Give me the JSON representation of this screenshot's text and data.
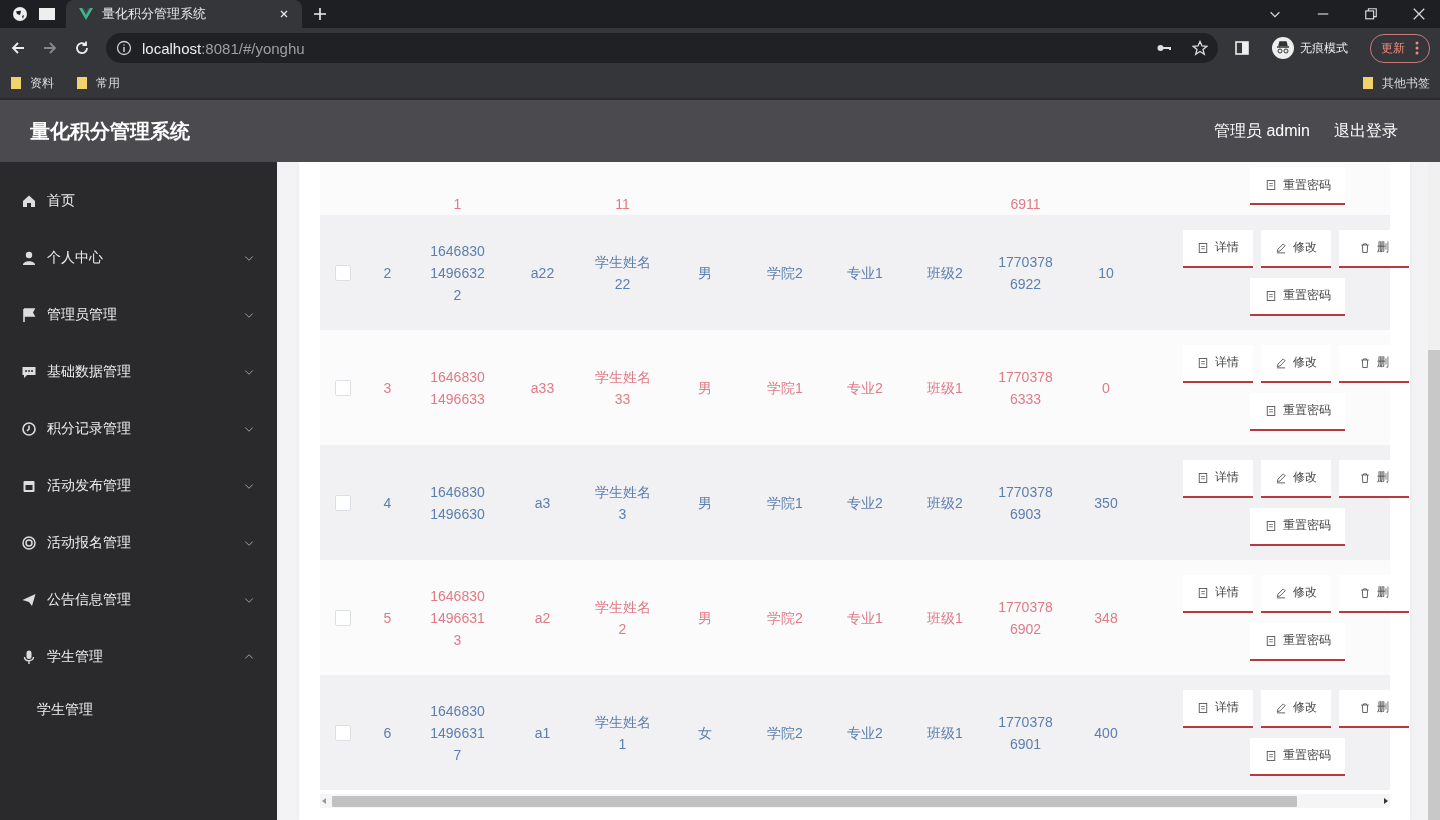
{
  "browser": {
    "tab": {
      "title": "量化积分管理系统",
      "selected": true
    },
    "url_host": "localhost",
    "url_path": ":8081/#/yonghu",
    "profile": "无痕模式",
    "update": "更新",
    "bookmarks": [
      "资料",
      "常用"
    ],
    "other_bookmarks": "其他书签"
  },
  "header": {
    "title": "量化积分管理系统",
    "user": "管理员 admin",
    "logout": "退出登录"
  },
  "sidebar": {
    "items": [
      {
        "label": "首页",
        "has_children": false
      },
      {
        "label": "个人中心",
        "has_children": true,
        "expanded": false
      },
      {
        "label": "管理员管理",
        "has_children": true,
        "expanded": false
      },
      {
        "label": "基础数据管理",
        "has_children": true,
        "expanded": false
      },
      {
        "label": "积分记录管理",
        "has_children": true,
        "expanded": false
      },
      {
        "label": "活动发布管理",
        "has_children": true,
        "expanded": false
      },
      {
        "label": "活动报名管理",
        "has_children": true,
        "expanded": false
      },
      {
        "label": "公告信息管理",
        "has_children": true,
        "expanded": false
      },
      {
        "label": "学生管理",
        "has_children": true,
        "expanded": true,
        "children": [
          {
            "label": "学生管理"
          }
        ]
      }
    ]
  },
  "table": {
    "clipped_row": {
      "color": "#e07a86",
      "account": "1",
      "name": "11",
      "phone": "6911",
      "reset": "重置密码"
    },
    "rows": [
      {
        "checked": false,
        "color": "#5b7fae",
        "index": "2",
        "account": "164683014966322",
        "username": "a22",
        "name": "学生姓名22",
        "gender": "男",
        "college": "学院2",
        "major": "专业1",
        "class": "班级2",
        "phone": "17703786922",
        "points": "10",
        "actions": [
          {
            "kind": "detail",
            "label": "详情"
          },
          {
            "kind": "edit",
            "label": "修改"
          },
          {
            "kind": "delete",
            "label": "删"
          },
          {
            "kind": "reset",
            "label": "重置密码"
          }
        ]
      },
      {
        "checked": false,
        "color": "#e07a86",
        "index": "3",
        "account": "16468301496633",
        "username": "a33",
        "name": "学生姓名33",
        "gender": "男",
        "college": "学院1",
        "major": "专业2",
        "class": "班级1",
        "phone": "17703786333",
        "points": "0",
        "actions": [
          {
            "kind": "detail",
            "label": "详情"
          },
          {
            "kind": "edit",
            "label": "修改"
          },
          {
            "kind": "delete",
            "label": "删"
          },
          {
            "kind": "reset",
            "label": "重置密码"
          }
        ]
      },
      {
        "checked": false,
        "color": "#5b7fae",
        "index": "4",
        "account": "16468301496630",
        "username": "a3",
        "name": "学生姓名3",
        "gender": "男",
        "college": "学院1",
        "major": "专业2",
        "class": "班级2",
        "phone": "17703786903",
        "points": "350",
        "actions": [
          {
            "kind": "detail",
            "label": "详情"
          },
          {
            "kind": "edit",
            "label": "修改"
          },
          {
            "kind": "delete",
            "label": "删"
          },
          {
            "kind": "reset",
            "label": "重置密码"
          }
        ]
      },
      {
        "checked": false,
        "color": "#e07a86",
        "index": "5",
        "account": "164683014966313",
        "username": "a2",
        "name": "学生姓名2",
        "gender": "男",
        "college": "学院2",
        "major": "专业1",
        "class": "班级1",
        "phone": "17703786902",
        "points": "348",
        "actions": [
          {
            "kind": "detail",
            "label": "详情"
          },
          {
            "kind": "edit",
            "label": "修改"
          },
          {
            "kind": "delete",
            "label": "删"
          },
          {
            "kind": "reset",
            "label": "重置密码"
          }
        ]
      },
      {
        "checked": false,
        "color": "#5b7fae",
        "index": "6",
        "account": "164683014966317",
        "username": "a1",
        "name": "学生姓名1",
        "gender": "女",
        "college": "学院2",
        "major": "专业2",
        "class": "班级1",
        "phone": "17703786901",
        "points": "400",
        "actions": [
          {
            "kind": "detail",
            "label": "详情"
          },
          {
            "kind": "edit",
            "label": "修改"
          },
          {
            "kind": "delete",
            "label": "删"
          },
          {
            "kind": "reset",
            "label": "重置密码"
          }
        ]
      }
    ]
  }
}
